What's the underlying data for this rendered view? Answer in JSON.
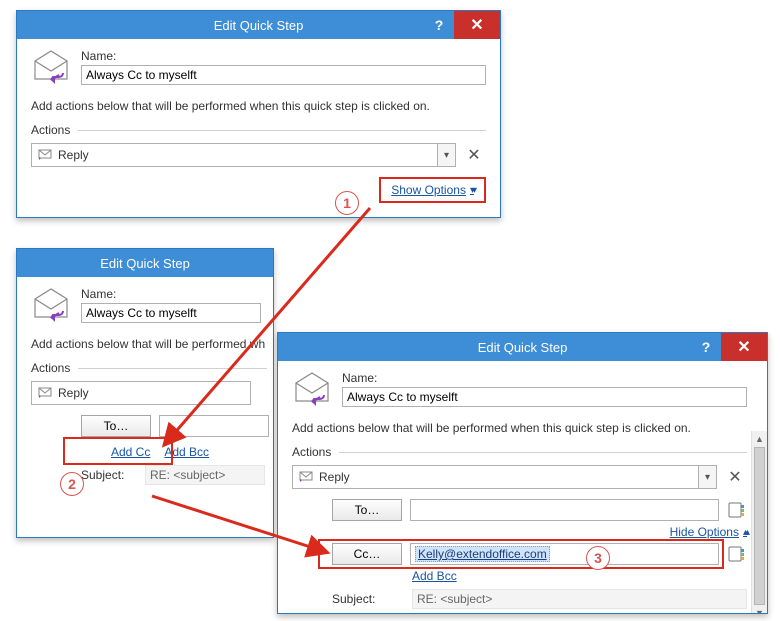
{
  "step_labels": {
    "s1": "1",
    "s2": "2",
    "s3": "3"
  },
  "common": {
    "title": "Edit Quick Step",
    "name_label": "Name:",
    "name_value": "Always Cc to myselft",
    "instruction": "Add actions below that will be performed when this quick step is clicked on.",
    "instruction_trunc": "Add actions below that will be performed wh",
    "actions_label": "Actions",
    "reply_label": "Reply",
    "show_options": "Show Options",
    "hide_options": "Hide Options",
    "to_button": "To…",
    "cc_button": "Cc…",
    "add_cc": "Add Cc",
    "add_bcc": "Add Bcc",
    "subject_label": "Subject:",
    "subject_value": "RE: <subject>"
  },
  "dialog3": {
    "cc_value": "Kelly@extendoffice.com"
  }
}
